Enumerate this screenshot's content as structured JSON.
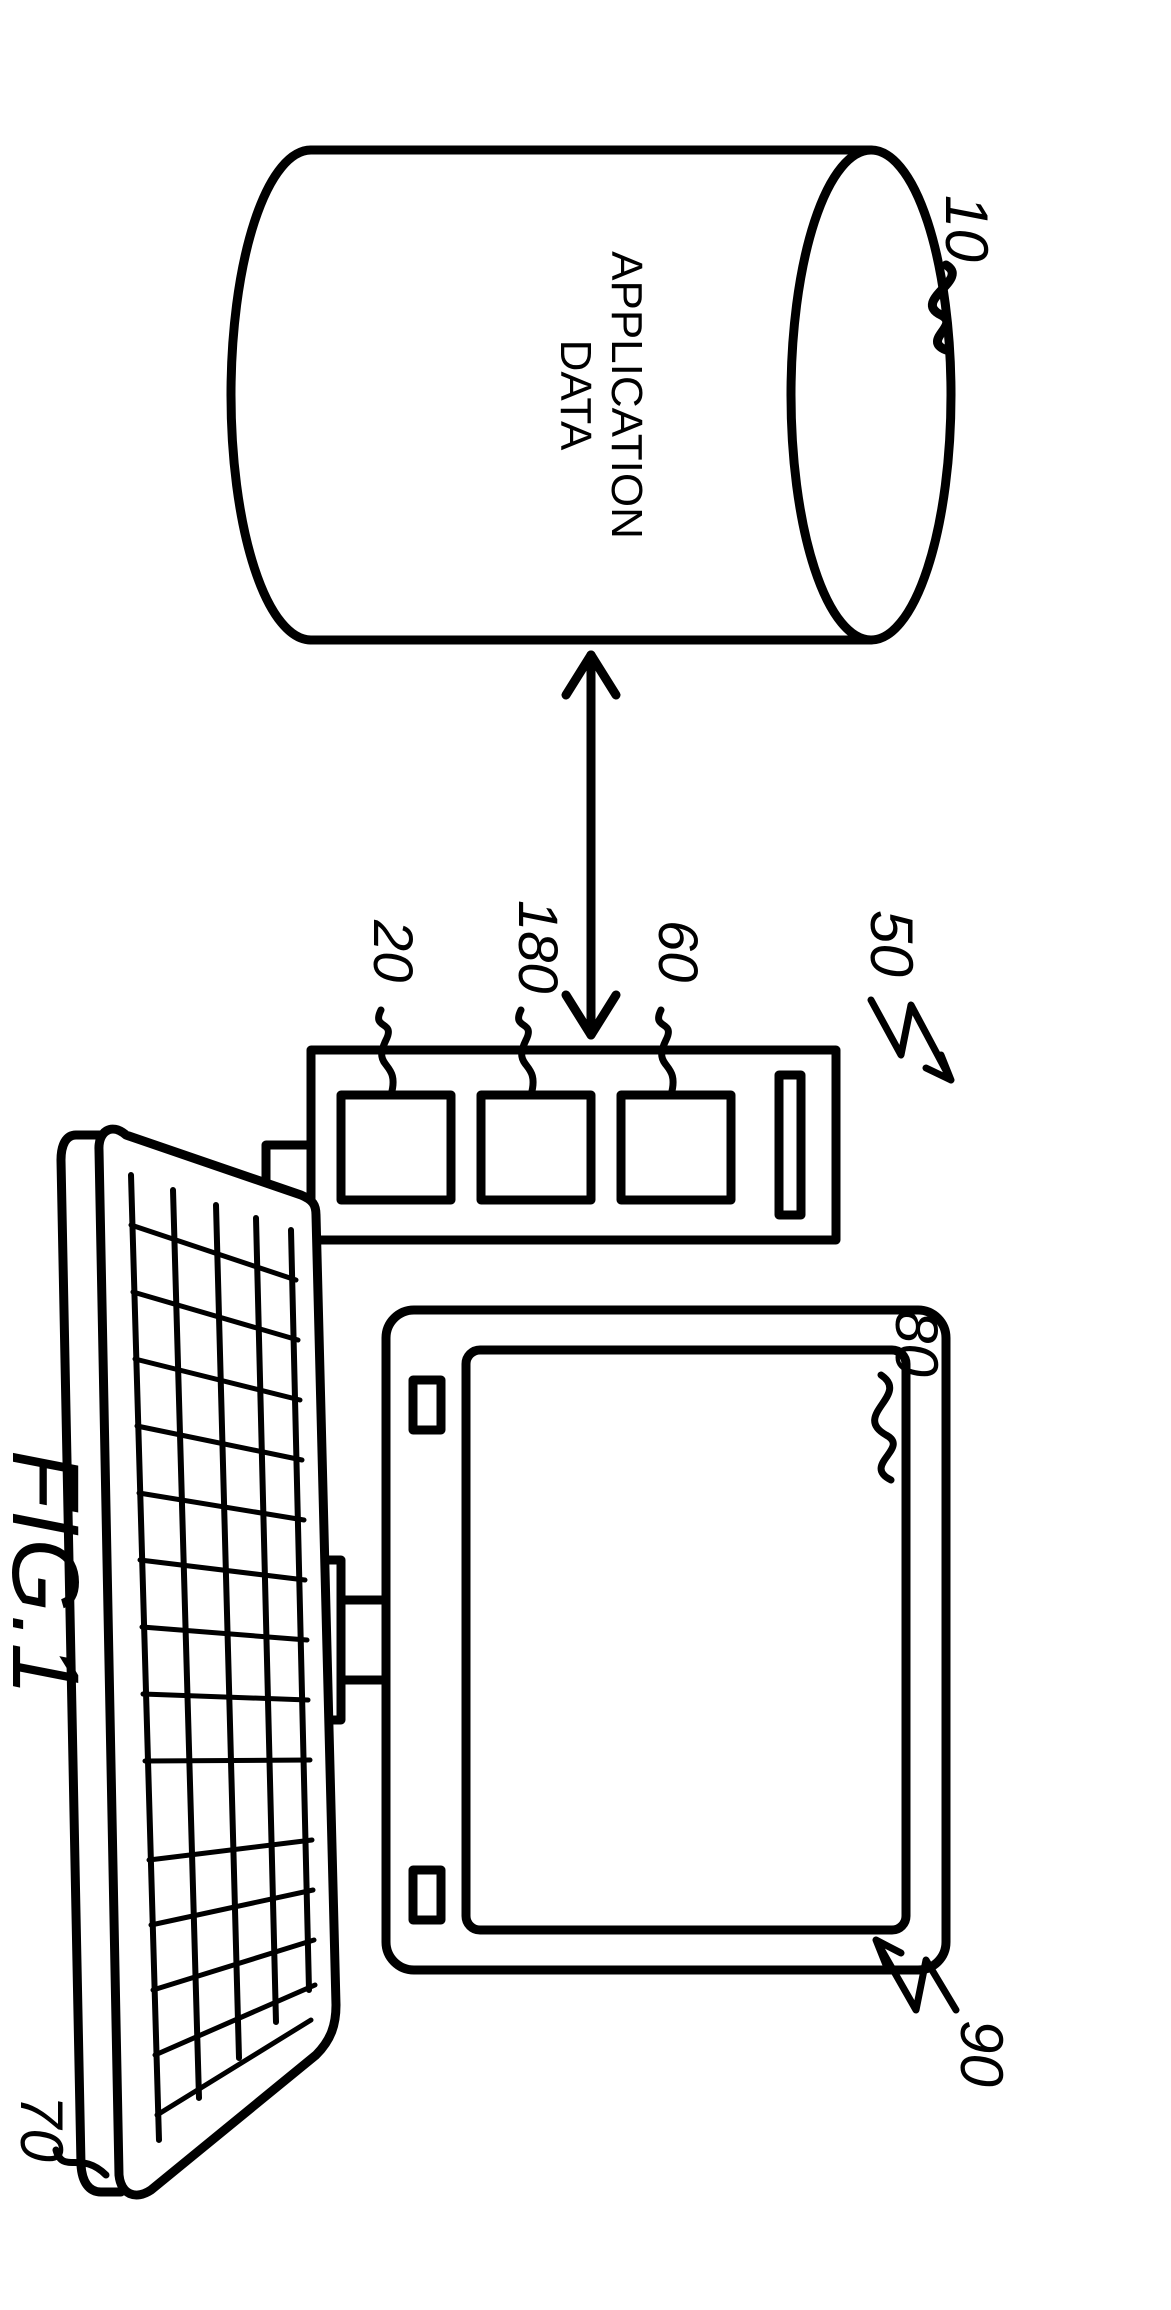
{
  "labels": {
    "db_text_line1": "APPLICATION",
    "db_text_line2": "DATA",
    "ref_10": "10",
    "ref_50": "50",
    "ref_60": "60",
    "ref_180": "180",
    "ref_20": "20",
    "ref_80": "80",
    "ref_90": "90",
    "ref_70": "70",
    "figure": "FIG.1"
  }
}
